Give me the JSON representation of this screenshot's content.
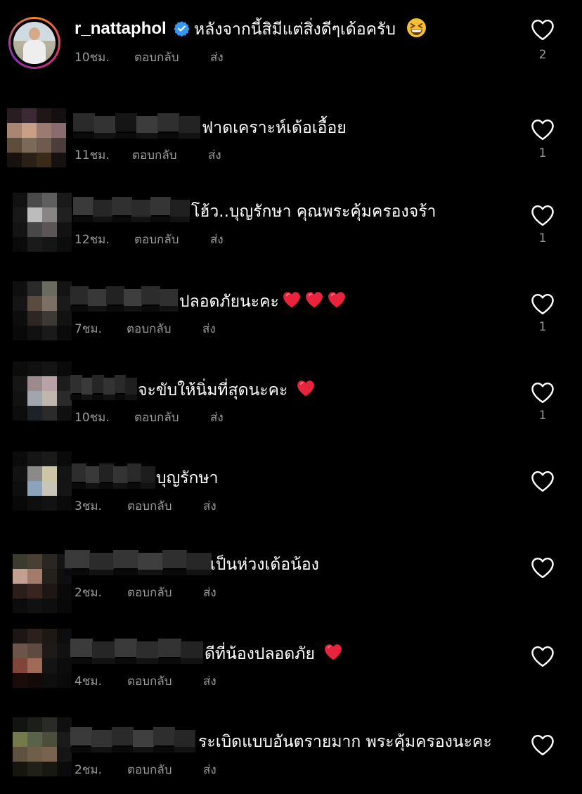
{
  "colors": {
    "background": "#000000",
    "text": "#ffffff",
    "meta": "#9a9a9a",
    "verified": "#3897f0",
    "heart_emoji": "#e8243c"
  },
  "icons": {
    "like": "heart-outline-icon",
    "verified": "verified-badge-icon",
    "emoji": "grinning-squinting-face-emoji",
    "heart_emoji": "red-heart-emoji"
  },
  "post_comment": {
    "username": "r_nattaphol",
    "text": "หลังจากนี้สิมีแต่สิ่งดีๆเด้อครับ",
    "emoji": "😆",
    "time": "10ชม.",
    "reply": "ตอบกลับ",
    "send": "ส่ง",
    "likes": "2"
  },
  "comments": [
    {
      "text": "ฟาดเคราะห์เด้อเอื้อย",
      "time": "11ชม.",
      "reply": "ตอบกลับ",
      "send": "ส่ง",
      "likes": "1"
    },
    {
      "text": "โฮ้ว..บุญรักษา คุณพระคุ้มครองจร้า",
      "time": "12ชม.",
      "reply": "ตอบกลับ",
      "send": "ส่ง",
      "likes": "1"
    },
    {
      "text": "ปลอดภัยนะคะ",
      "hearts": 3,
      "time": "7ชม.",
      "reply": "ตอบกลับ",
      "send": "ส่ง",
      "likes": "1"
    },
    {
      "text": "จะขับให้นิ่มที่สุดนะคะ",
      "hearts": 1,
      "time": "10ชม.",
      "reply": "ตอบกลับ",
      "send": "ส่ง",
      "likes": "1"
    },
    {
      "text": "บุญรักษา",
      "time": "3ชม.",
      "reply": "ตอบกลับ",
      "send": "ส่ง",
      "likes": ""
    },
    {
      "text": "เป็นห่วงเด้อน้อง",
      "time": "2ชม.",
      "reply": "ตอบกลับ",
      "send": "ส่ง",
      "likes": ""
    },
    {
      "text": "ดีที่น้องปลอดภัย",
      "hearts": 1,
      "time": "4ชม.",
      "reply": "ตอบกลับ",
      "send": "ส่ง",
      "likes": ""
    },
    {
      "text": "ระเบิดแบบอันตรายมาก  พระคุ้มครองนะคะ",
      "time": "2ชม.",
      "reply": "ตอบกลับ",
      "send": "ส่ง",
      "likes": ""
    }
  ]
}
